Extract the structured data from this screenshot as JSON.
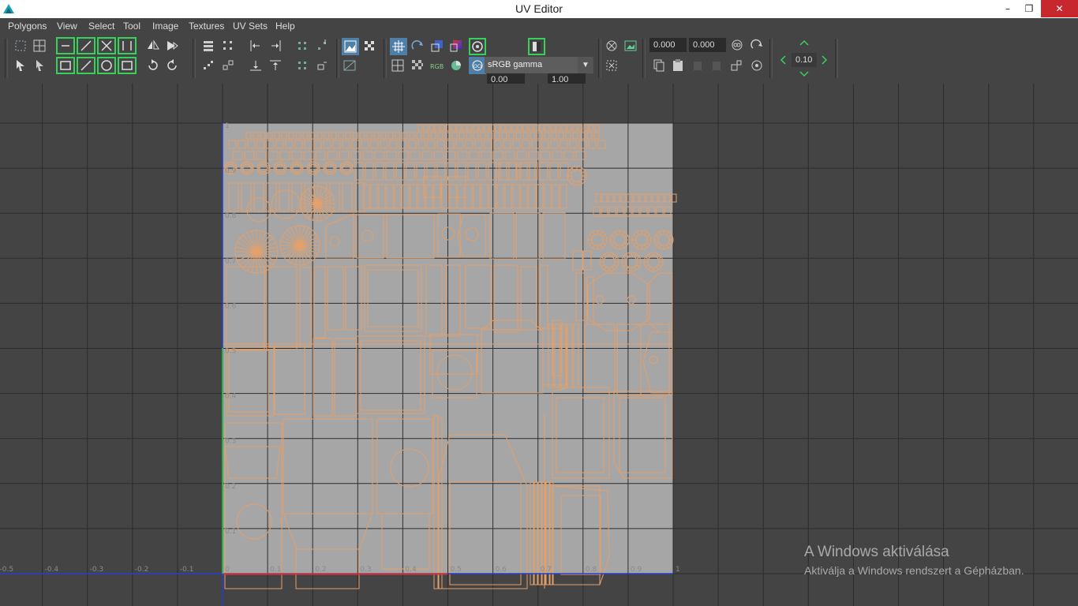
{
  "window": {
    "title": "UV Editor",
    "minimize": "–",
    "maximize": "❐",
    "close": "✕"
  },
  "menu": [
    "Polygons",
    "View",
    "Select",
    "Tool",
    "Image",
    "Textures",
    "UV Sets",
    "Help"
  ],
  "toolbar": {
    "exposure": "0.00",
    "gamma": "1.00",
    "color_space": "sRGB gamma",
    "coord_u": "0.000",
    "coord_v": "0.000",
    "step": "0.10"
  },
  "grid": {
    "u_labels": [
      "-0.5",
      "-0.4",
      "-0.3",
      "-0.2",
      "-0.1",
      "0",
      "0.1",
      "0.2",
      "0.3",
      "0.4",
      "0.5",
      "0.6",
      "0.7",
      "0.8",
      "0.9",
      "1"
    ],
    "v_labels": [
      "1",
      "0.9",
      "0.8",
      "0.7",
      "0.6",
      "0.5",
      "0.4",
      "0.3",
      "0.2",
      "0.1"
    ]
  },
  "watermark": {
    "title": "A Windows aktiválása",
    "subtitle": "Aktiválja a Windows rendszert a Gépházban."
  },
  "colors": {
    "uv_line": "#e3a06b",
    "texture_bg": "#a6a6a6",
    "grid": "#2c2c2c",
    "u_axis": "#d63030",
    "v_axis": "#27b34a",
    "axis_blue": "#2a3cd0",
    "close_button": "#c8282d",
    "toggle_blue": "#4f7fa6"
  },
  "icons": [
    "app-icon",
    "grid-snap-icon",
    "flip-icon",
    "rotate-icon",
    "checker-icon",
    "lock-icon",
    "arrow-icons"
  ]
}
